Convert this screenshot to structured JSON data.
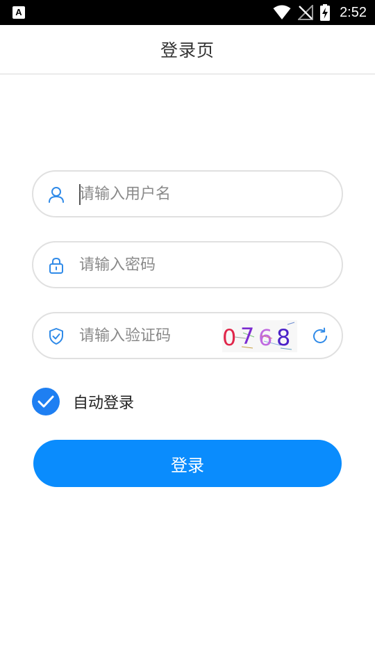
{
  "status_bar": {
    "app_icon_letter": "A",
    "time": "2:52"
  },
  "header": {
    "title": "登录页"
  },
  "form": {
    "username": {
      "placeholder": "请输入用户名",
      "value": ""
    },
    "password": {
      "placeholder": "请输入密码",
      "value": ""
    },
    "captcha": {
      "placeholder": "请输入验证码",
      "value": "",
      "image_digits": [
        "0",
        "7",
        "6",
        "8"
      ],
      "digit_colors": [
        "#e0264a",
        "#7b2bd0",
        "#c06ae0",
        "#4a22c8"
      ]
    },
    "auto_login": {
      "label": "自动登录",
      "checked": true
    },
    "submit_label": "登录"
  },
  "colors": {
    "accent": "#1e7ff2",
    "button": "#0a8cfd",
    "icon": "#2f8ae8"
  }
}
